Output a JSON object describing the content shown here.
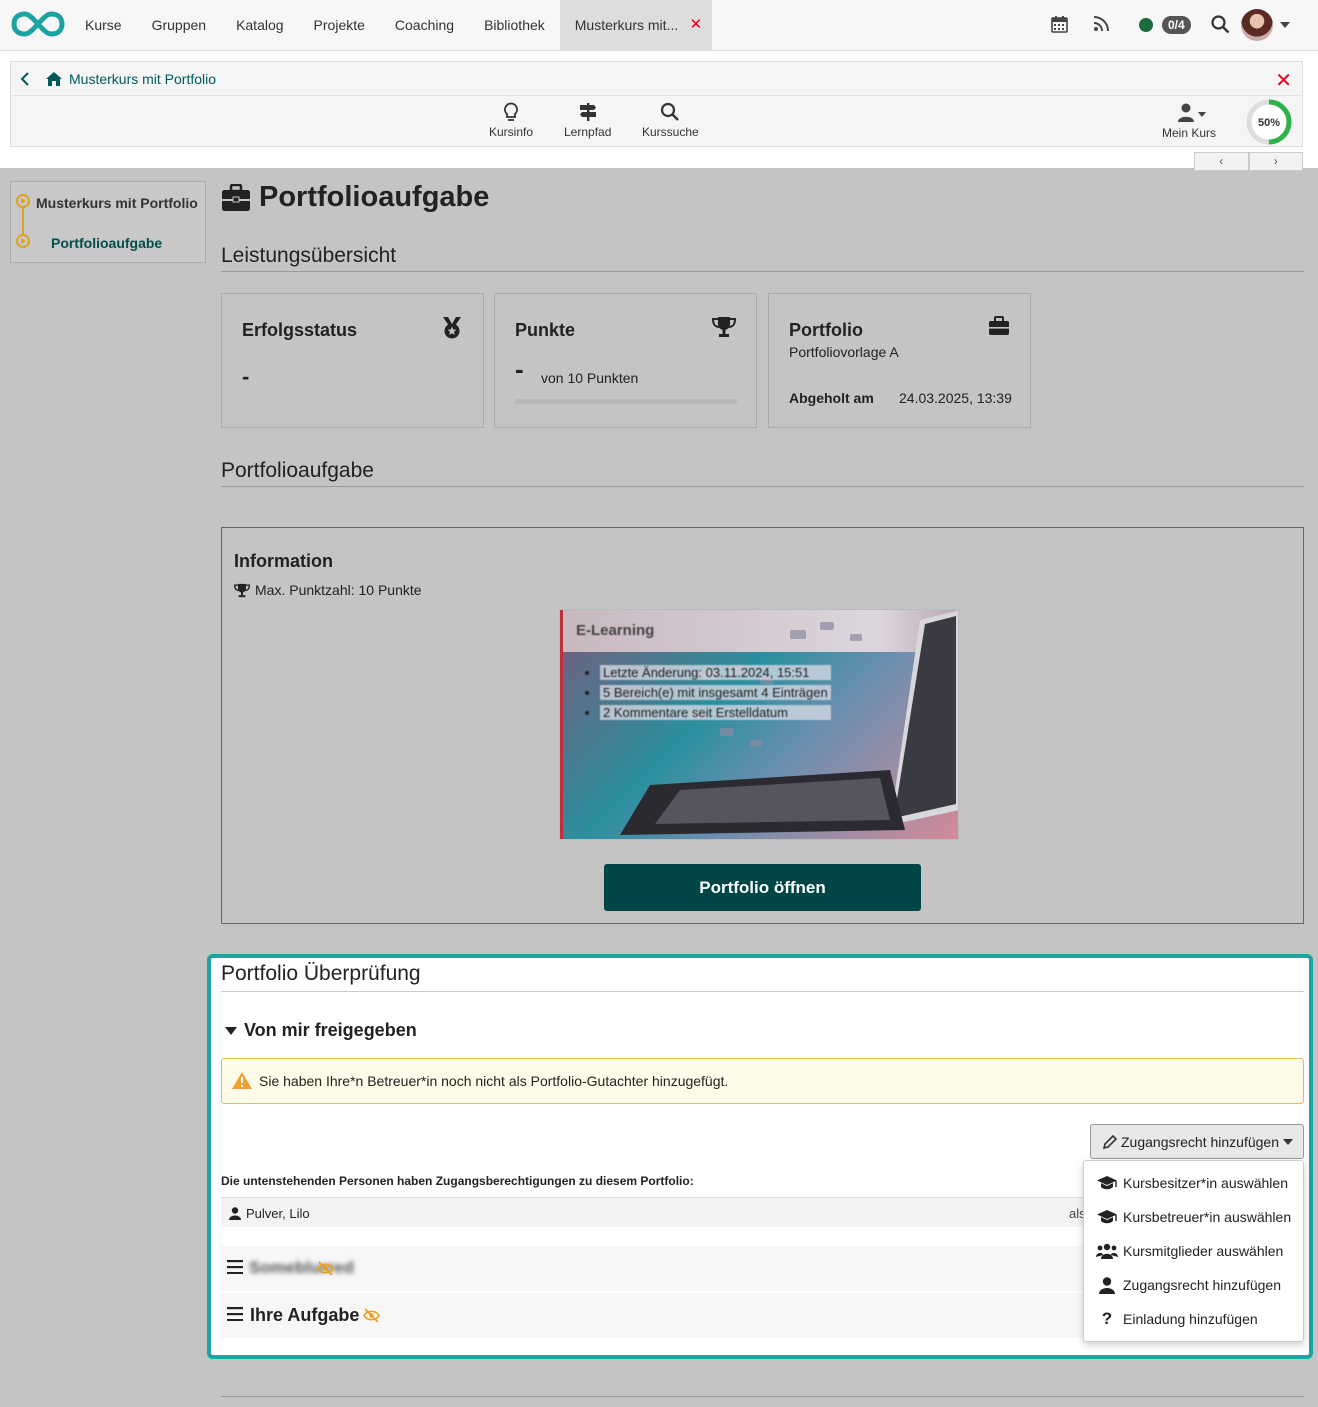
{
  "nav": {
    "items": [
      "Kurse",
      "Gruppen",
      "Katalog",
      "Projekte",
      "Coaching",
      "Bibliothek"
    ],
    "active_tab": "Musterkurs mit...",
    "active_tab_close": "✕",
    "badge": "0/4"
  },
  "course": {
    "title": "Musterkurs mit Portfolio",
    "tools": [
      "Kursinfo",
      "Lernpfad",
      "Kurssuche"
    ],
    "mein_kurs": "Mein Kurs",
    "progress_label": "50%",
    "progress_value": 0.5
  },
  "menu": {
    "root": "Musterkurs mit Portfolio",
    "current": "Portfolioaufgabe"
  },
  "page": {
    "title": "Portfolioaufgabe",
    "section_overview": "Leistungsübersicht",
    "section_task": "Portfolioaufgabe"
  },
  "cards": {
    "status": {
      "title": "Erfolgsstatus",
      "value": "-"
    },
    "points": {
      "title": "Punkte",
      "value": "-",
      "of": "von 10 Punkten"
    },
    "portfolio": {
      "title": "Portfolio",
      "template": "Portfoliovorlage A",
      "fetched_label": "Abgeholt am",
      "fetched_value": "24.03.2025, 13:39"
    }
  },
  "info": {
    "title": "Information",
    "max_points": "Max. Punktzahl: 10 Punkte",
    "preview_title": "E-Learning",
    "preview_lines": [
      "Letzte Änderung: 03.11.2024, 15:51",
      "5 Bereich(e) mit insgesamt 4 Einträgen",
      "2 Kommentare seit Erstelldatum"
    ],
    "open_button": "Portfolio öffnen"
  },
  "review": {
    "title": "Portfolio Überprüfung",
    "subsection": "Von mir freigegeben",
    "warning": "Sie haben Ihre*n Betreuer*in noch nicht als Portfolio-Gutachter hinzugefügt.",
    "add_access_button": "Zugangsrecht hinzufügen",
    "permissions_label": "Die untenstehenden Personen haben Zugangsberechtigungen zu diesem Portfolio:",
    "person": "Pulver, Lilo",
    "person_role_fragment": "als",
    "section1": "Someblurred",
    "section2": "Ihre Aufgabe"
  },
  "dropdown": {
    "items": [
      "Kursbesitzer*in auswählen",
      "Kursbetreuer*in auswählen",
      "Kursmitglieder auswählen",
      "Zugangsrecht hinzufügen",
      "Einladung hinzufügen"
    ]
  },
  "colors": {
    "accent": "#004646",
    "highlight": "#1aa3a0",
    "close_red": "#e2001a",
    "progress_green": "#2db34a"
  }
}
